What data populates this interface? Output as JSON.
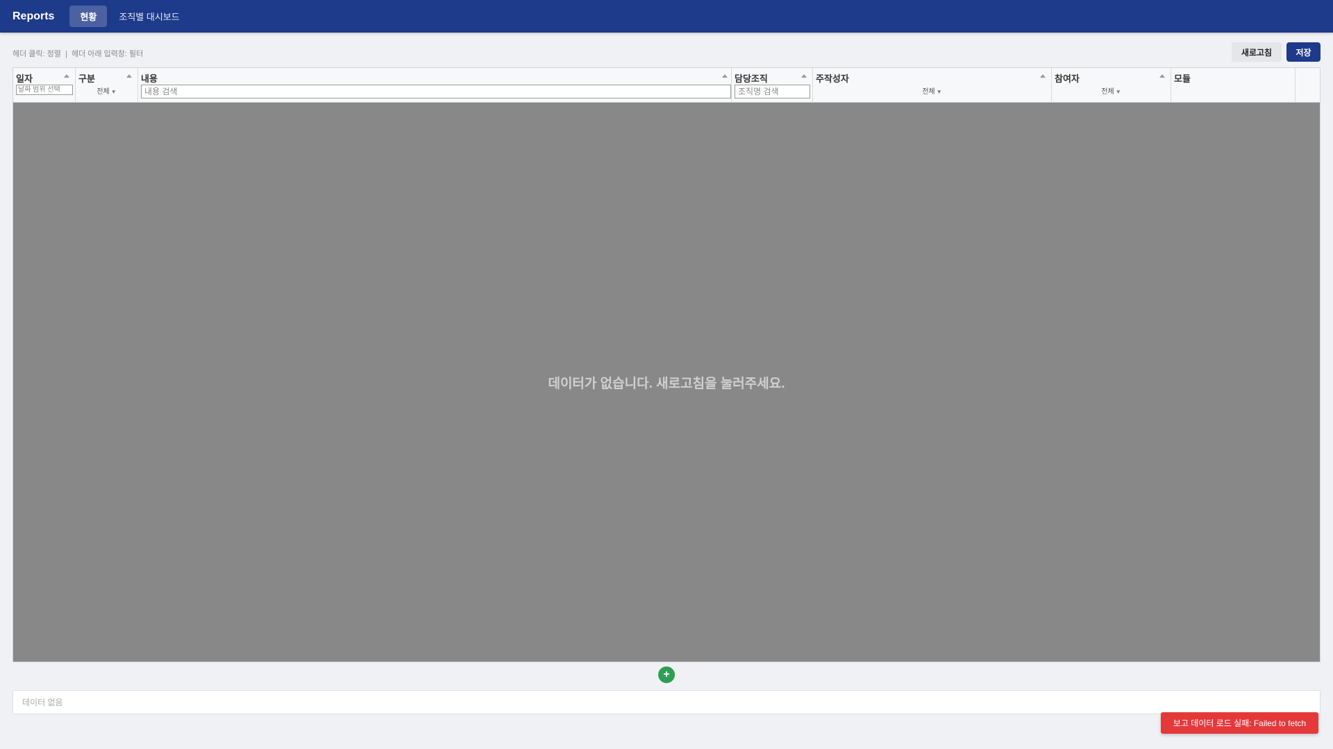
{
  "app": {
    "brand": "Reports"
  },
  "nav": {
    "tabs": [
      {
        "label": "현황",
        "active": true
      },
      {
        "label": "조직별 대시보드",
        "active": false
      }
    ]
  },
  "toolbar": {
    "hint": "헤더 클릭: 정렬  |  헤더 아래 입력창: 필터",
    "refresh_label": "새로고침",
    "save_label": "저장"
  },
  "grid": {
    "columns": [
      {
        "title": "일자",
        "filter_placeholder": "날짜 범위 선택",
        "sortable": true
      },
      {
        "title": "구분",
        "filter_select": "전체",
        "sortable": true
      },
      {
        "title": "내용",
        "filter_placeholder": "내용 검색",
        "sortable": true
      },
      {
        "title": "담당조직",
        "filter_placeholder": "조직명 검색",
        "sortable": true
      },
      {
        "title": "주작성자",
        "filter_select": "전체",
        "sortable": true
      },
      {
        "title": "참여자",
        "filter_select": "전체",
        "sortable": true
      },
      {
        "title": "모듈",
        "sortable": false
      }
    ],
    "empty_message": "데이터가 없습니다. 새로고침을 눌러주세요."
  },
  "add_button": {
    "label": "+",
    "color": "#2e9e52"
  },
  "bottom_panel": {
    "text": "데이터 없음"
  },
  "toast": {
    "message": "보고 데이터 로드 실패: Failed to fetch",
    "color": "#e5383b"
  },
  "colors": {
    "primary": "#1e3a8a",
    "grid_body": "#888888"
  }
}
